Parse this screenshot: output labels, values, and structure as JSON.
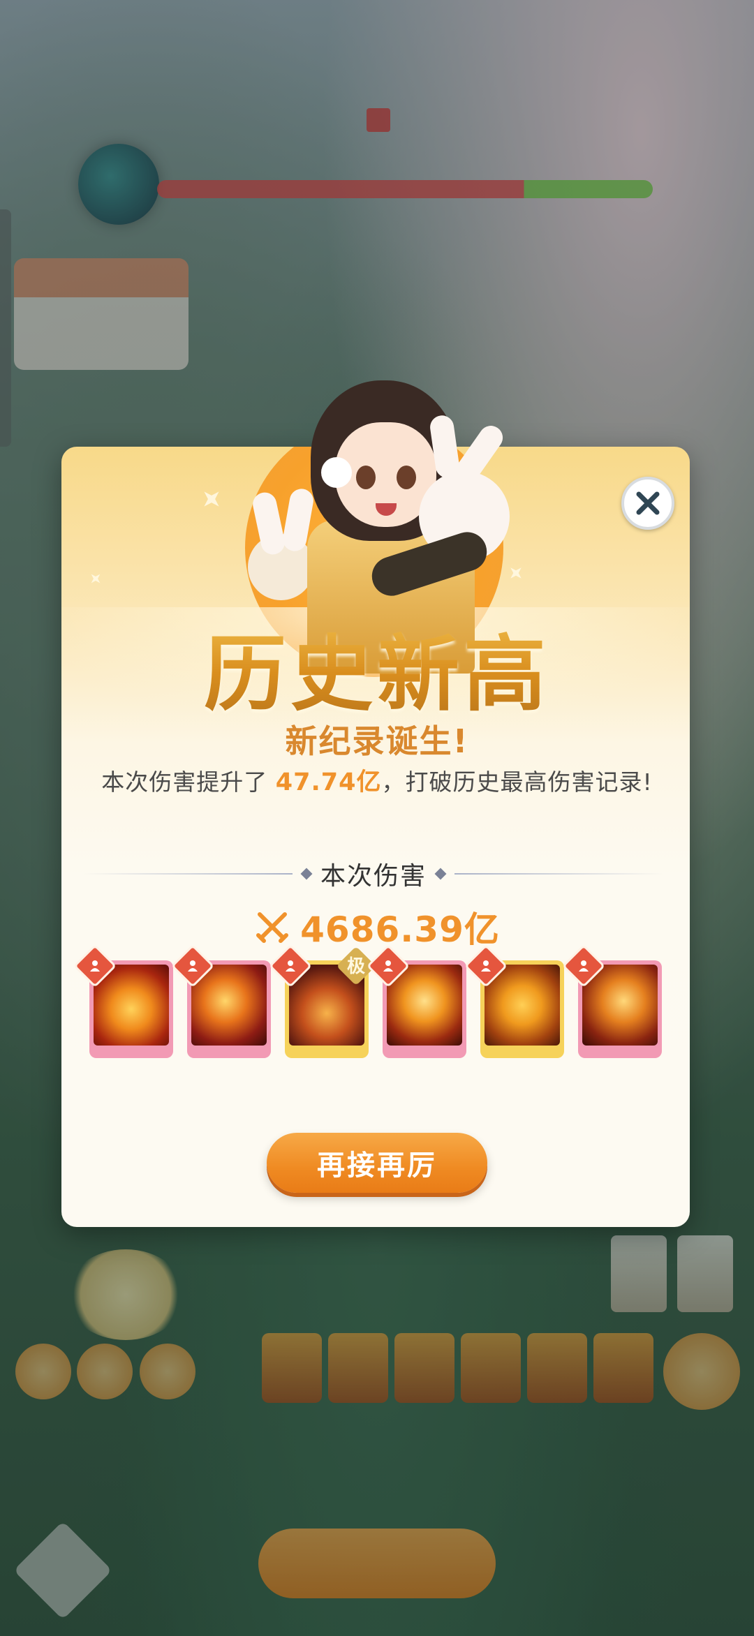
{
  "modal": {
    "title": "历史新高",
    "subtitle": "新纪录诞生!",
    "description_prefix": "本次伤害提升了 ",
    "description_highlight": "47.74亿",
    "description_suffix": "，打破历史最高伤害记录!",
    "section_label": "本次伤害",
    "damage_value": "4686.39亿",
    "again_button": "再接再厉",
    "close_icon": "close-icon"
  },
  "skills": [
    {
      "name": "lotus-skill-icon",
      "frame": "pink",
      "rank": ""
    },
    {
      "name": "phoenix-skill-icon",
      "frame": "pink",
      "rank": ""
    },
    {
      "name": "flame-figure-skill-icon",
      "frame": "gold",
      "rank": "极"
    },
    {
      "name": "pagoda-skill-icon",
      "frame": "pink",
      "rank": ""
    },
    {
      "name": "buddha-skill-icon",
      "frame": "gold",
      "rank": ""
    },
    {
      "name": "fire-swirl-skill-icon",
      "frame": "pink",
      "rank": ""
    }
  ],
  "colors": {
    "accent_orange": "#f0922b",
    "title_gold": "#d99a2a",
    "frame_pink": "#f29ab4",
    "frame_gold": "#f6d25a",
    "badge_red": "#e5563e"
  }
}
